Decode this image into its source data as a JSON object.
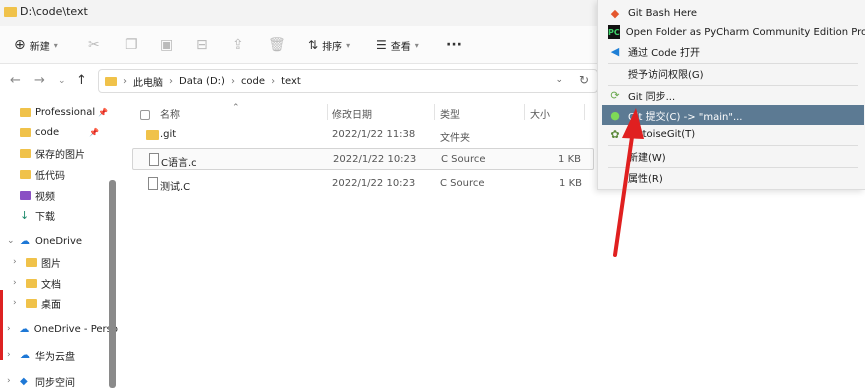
{
  "window": {
    "title": "D:\\code\\text"
  },
  "toolbar": {
    "new_label": "新建",
    "sort_label": "排序",
    "view_label": "查看"
  },
  "address": {
    "crumbs": [
      "此电脑",
      "Data (D:)",
      "code",
      "text"
    ]
  },
  "sidebar": {
    "items": [
      {
        "label": "Professional"
      },
      {
        "label": "code"
      },
      {
        "label": "保存的图片"
      },
      {
        "label": "低代码"
      },
      {
        "label": "视频"
      },
      {
        "label": "下载"
      },
      {
        "label": "OneDrive"
      },
      {
        "label": "图片"
      },
      {
        "label": "文档"
      },
      {
        "label": "桌面"
      },
      {
        "label": "OneDrive - Perso"
      },
      {
        "label": "华为云盘"
      },
      {
        "label": "同步空间"
      }
    ]
  },
  "columns": {
    "name": "名称",
    "date": "修改日期",
    "type": "类型",
    "size": "大小"
  },
  "files": [
    {
      "name": ".git",
      "date": "2022/1/22 11:38",
      "type": "文件夹",
      "size": ""
    },
    {
      "name": "C语言.c",
      "date": "2022/1/22 10:23",
      "type": "C Source",
      "size": "1 KB"
    },
    {
      "name": "测试.C",
      "date": "2022/1/22 10:23",
      "type": "C Source",
      "size": "1 KB"
    }
  ],
  "context_menu": {
    "items": [
      {
        "label": "Git Bash Here",
        "icon": "git-bash-icon"
      },
      {
        "label": "Open Folder as PyCharm Community Edition Project",
        "icon": "pycharm-icon"
      },
      {
        "label": "通过 Code 打开",
        "icon": "vscode-icon"
      },
      {
        "label": "授予访问权限(G)",
        "icon": ""
      },
      {
        "label": "Git 同步...",
        "icon": "git-sync-icon"
      },
      {
        "label": "Git 提交(C) -> \"main\"...",
        "icon": "git-commit-icon",
        "highlighted": true
      },
      {
        "label": "TortoiseGit(T)",
        "icon": "tortoisegit-icon"
      },
      {
        "label": "新建(W)",
        "icon": ""
      },
      {
        "label": "属性(R)",
        "icon": ""
      }
    ]
  },
  "colors": {
    "highlight": "#5c7a93",
    "folder": "#f0c24a",
    "arrow": "#e02020"
  }
}
